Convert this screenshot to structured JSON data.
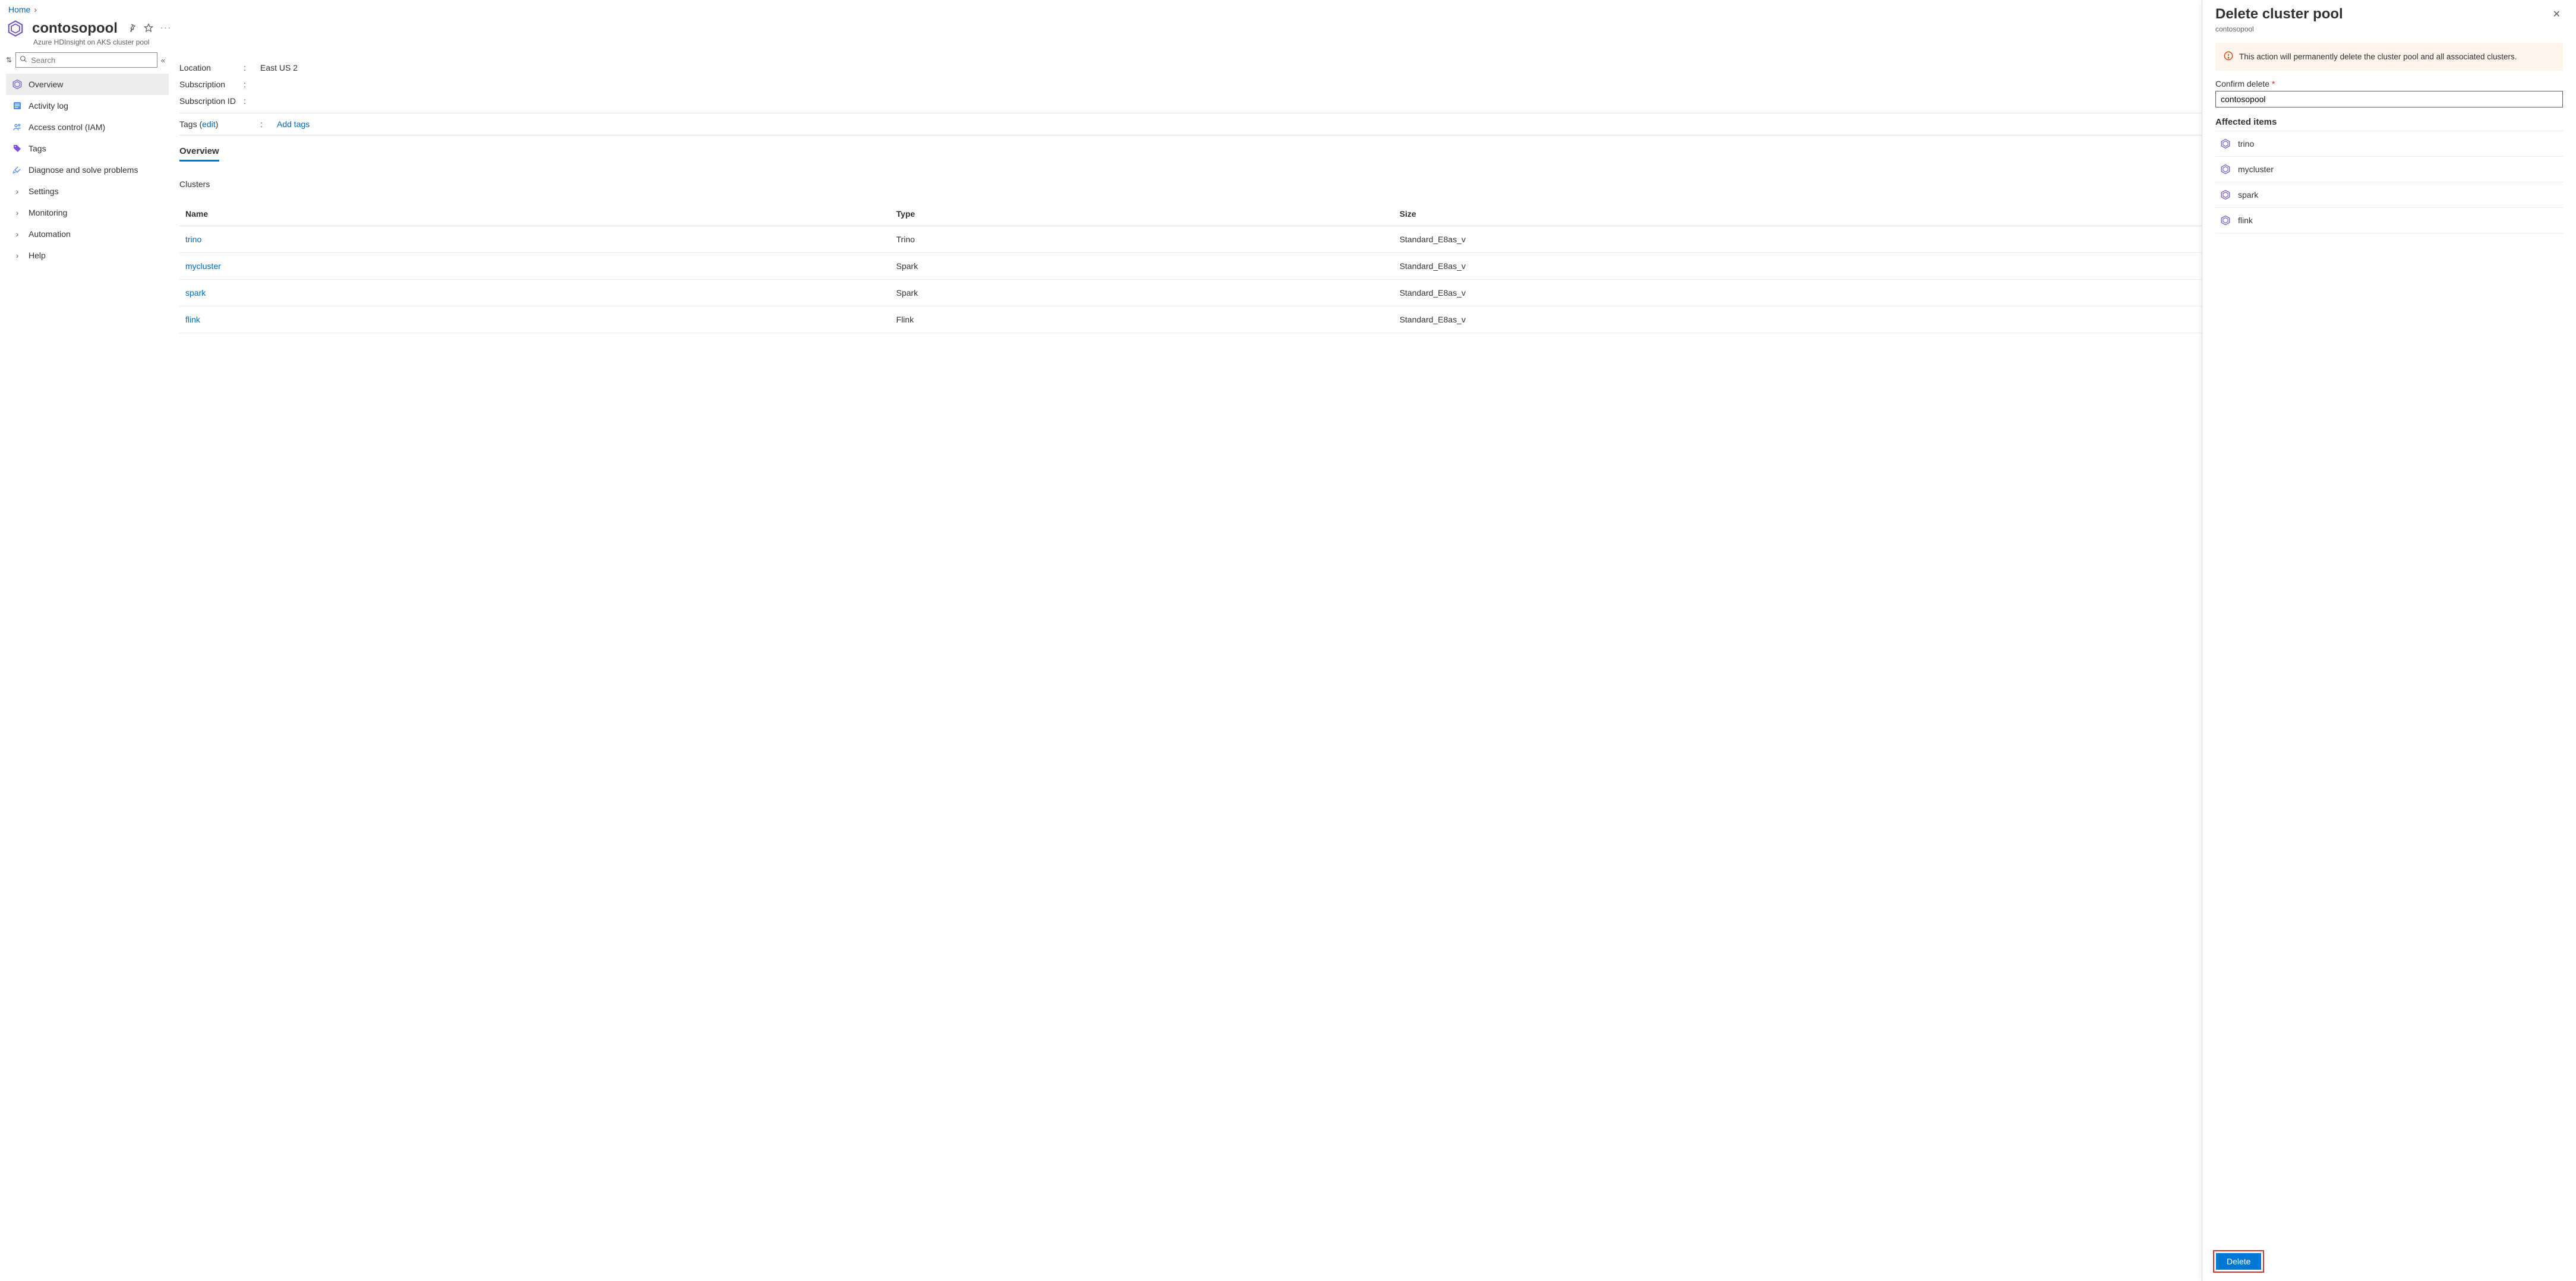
{
  "breadcrumb": {
    "home": "Home"
  },
  "header": {
    "title": "contosopool",
    "subtitle": "Azure HDInsight on AKS cluster pool"
  },
  "search": {
    "placeholder": "Search"
  },
  "sidebar": {
    "items": [
      {
        "label": "Overview"
      },
      {
        "label": "Activity log"
      },
      {
        "label": "Access control (IAM)"
      },
      {
        "label": "Tags"
      },
      {
        "label": "Diagnose and solve problems"
      },
      {
        "label": "Settings"
      },
      {
        "label": "Monitoring"
      },
      {
        "label": "Automation"
      },
      {
        "label": "Help"
      }
    ]
  },
  "details": {
    "location_label": "Location",
    "location_value": "East US 2",
    "subscription_label": "Subscription",
    "subscription_id_label": "Subscription ID",
    "tags_label": "Tags",
    "edit_link": "edit",
    "add_tags": "Add tags"
  },
  "tabs": {
    "overview": "Overview"
  },
  "clusters": {
    "heading": "Clusters",
    "columns": {
      "name": "Name",
      "type": "Type",
      "size": "Size"
    },
    "rows": [
      {
        "name": "trino",
        "type": "Trino",
        "size": "Standard_E8as_v"
      },
      {
        "name": "mycluster",
        "type": "Spark",
        "size": "Standard_E8as_v"
      },
      {
        "name": "spark",
        "type": "Spark",
        "size": "Standard_E8as_v"
      },
      {
        "name": "flink",
        "type": "Flink",
        "size": "Standard_E8as_v"
      }
    ]
  },
  "panel": {
    "title": "Delete cluster pool",
    "subtitle": "contosopool",
    "warning": "This action will permanently delete the cluster pool and all associated clusters.",
    "confirm_label": "Confirm delete",
    "confirm_value": "contosopool",
    "affected_heading": "Affected items",
    "affected": [
      {
        "name": "trino"
      },
      {
        "name": "mycluster"
      },
      {
        "name": "spark"
      },
      {
        "name": "flink"
      }
    ],
    "delete_button": "Delete"
  }
}
